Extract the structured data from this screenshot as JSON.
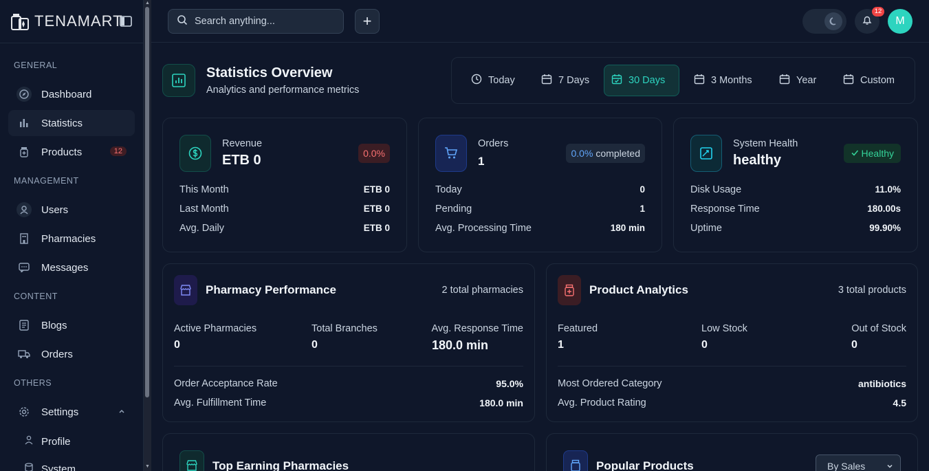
{
  "brand": {
    "name": "TENAMART"
  },
  "search": {
    "placeholder": "Search anything..."
  },
  "notifications": {
    "count": "12"
  },
  "user": {
    "initial": "M"
  },
  "sidebar": {
    "sections": [
      "GENERAL",
      "MANAGEMENT",
      "CONTENT",
      "OTHERS"
    ],
    "items": [
      {
        "label": "Dashboard",
        "icon": "compass-icon"
      },
      {
        "label": "Statistics",
        "icon": "bar-chart-icon"
      },
      {
        "label": "Products",
        "icon": "medicine-bottle-icon",
        "badge": "12"
      },
      {
        "label": "Users",
        "icon": "user-icon"
      },
      {
        "label": "Pharmacies",
        "icon": "building-icon"
      },
      {
        "label": "Messages",
        "icon": "message-icon"
      },
      {
        "label": "Blogs",
        "icon": "newspaper-icon"
      },
      {
        "label": "Orders",
        "icon": "truck-icon"
      },
      {
        "label": "Settings",
        "icon": "gear-icon"
      }
    ],
    "sub_items": [
      {
        "label": "Profile",
        "icon": "user-icon"
      },
      {
        "label": "System",
        "icon": "database-icon"
      }
    ]
  },
  "header": {
    "title": "Statistics Overview",
    "subtitle": "Analytics and performance metrics",
    "ranges": [
      "Today",
      "7 Days",
      "30 Days",
      "3 Months",
      "Year",
      "Custom"
    ],
    "active_range": "30 Days"
  },
  "revenue": {
    "label": "Revenue",
    "value": "ETB 0",
    "badge": "0.0%",
    "rows": [
      {
        "label": "This Month",
        "value": "ETB 0"
      },
      {
        "label": "Last Month",
        "value": "ETB 0"
      },
      {
        "label": "Avg. Daily",
        "value": "ETB 0"
      }
    ]
  },
  "orders": {
    "label": "Orders",
    "value": "1",
    "badge_pct": "0.0%",
    "badge_text": "completed",
    "rows": [
      {
        "label": "Today",
        "value": "0"
      },
      {
        "label": "Pending",
        "value": "1"
      },
      {
        "label": "Avg. Processing Time",
        "value": "180 min"
      }
    ]
  },
  "health": {
    "label": "System Health",
    "value": "healthy",
    "badge": "Healthy",
    "rows": [
      {
        "label": "Disk Usage",
        "value": "11.0%"
      },
      {
        "label": "Response Time",
        "value": "180.00s"
      },
      {
        "label": "Uptime",
        "value": "99.90%"
      }
    ]
  },
  "pharmacy_perf": {
    "title": "Pharmacy Performance",
    "count": "2 total pharmacies",
    "stats": [
      {
        "label": "Active Pharmacies",
        "value": "0"
      },
      {
        "label": "Total Branches",
        "value": "0"
      },
      {
        "label": "Avg. Response Time",
        "value": "180.0 min"
      }
    ],
    "rows": [
      {
        "label": "Order Acceptance Rate",
        "value": "95.0%"
      },
      {
        "label": "Avg. Fulfillment Time",
        "value": "180.0 min"
      }
    ]
  },
  "product_analytics": {
    "title": "Product Analytics",
    "count": "3 total products",
    "stats": [
      {
        "label": "Featured",
        "value": "1"
      },
      {
        "label": "Low Stock",
        "value": "0"
      },
      {
        "label": "Out of Stock",
        "value": "0"
      }
    ],
    "rows": [
      {
        "label": "Most Ordered Category",
        "value": "antibiotics"
      },
      {
        "label": "Avg. Product Rating",
        "value": "4.5"
      }
    ]
  },
  "top_earning": {
    "title": "Top Earning Pharmacies"
  },
  "popular_products": {
    "title": "Popular Products",
    "sort_value": "By Sales"
  },
  "colors": {
    "accent": "#2dd4bf",
    "background": "#0f172a",
    "danger": "#f87171",
    "info": "#60a5fa",
    "success": "#34d399"
  }
}
